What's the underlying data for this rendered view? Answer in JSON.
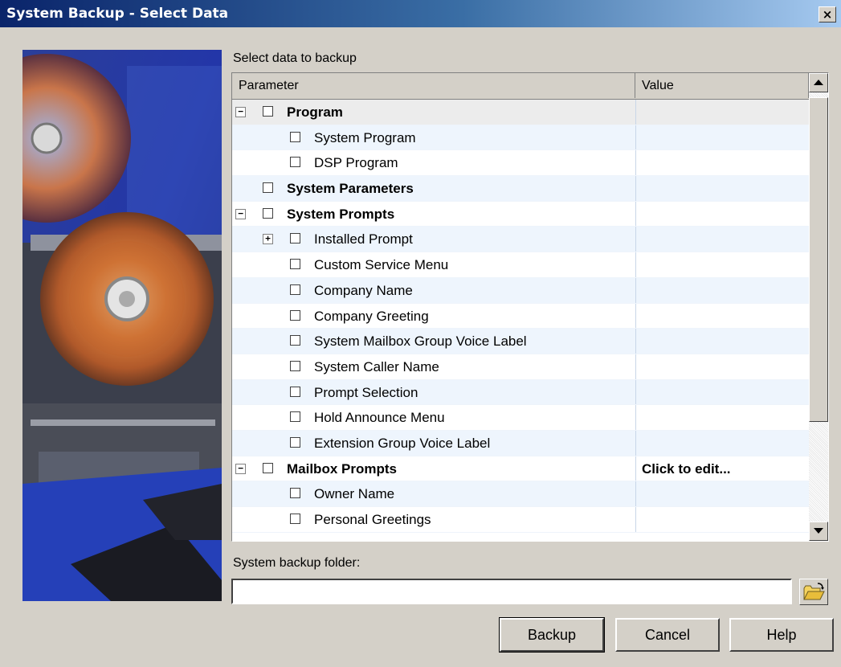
{
  "window": {
    "title": "System Backup - Select Data",
    "close_glyph": "×"
  },
  "select_label": "Select data to backup",
  "grid": {
    "columns": [
      "Parameter",
      "Value"
    ],
    "rows": [
      {
        "label": "Program",
        "bold": true,
        "level": 0,
        "expander": "−",
        "value": ""
      },
      {
        "label": "System Program",
        "bold": false,
        "level": 1,
        "expander": "",
        "value": ""
      },
      {
        "label": "DSP Program",
        "bold": false,
        "level": 1,
        "expander": "",
        "value": ""
      },
      {
        "label": "System Parameters",
        "bold": true,
        "level": 0,
        "expander": "",
        "value": ""
      },
      {
        "label": "System Prompts",
        "bold": true,
        "level": 0,
        "expander": "−",
        "value": ""
      },
      {
        "label": "Installed Prompt",
        "bold": false,
        "level": 1,
        "expander": "+",
        "value": ""
      },
      {
        "label": "Custom Service Menu",
        "bold": false,
        "level": 1,
        "expander": "",
        "value": ""
      },
      {
        "label": "Company Name",
        "bold": false,
        "level": 1,
        "expander": "",
        "value": ""
      },
      {
        "label": "Company Greeting",
        "bold": false,
        "level": 1,
        "expander": "",
        "value": ""
      },
      {
        "label": "System Mailbox Group Voice Label",
        "bold": false,
        "level": 1,
        "expander": "",
        "value": ""
      },
      {
        "label": "System Caller Name",
        "bold": false,
        "level": 1,
        "expander": "",
        "value": ""
      },
      {
        "label": "Prompt Selection",
        "bold": false,
        "level": 1,
        "expander": "",
        "value": ""
      },
      {
        "label": "Hold Announce Menu",
        "bold": false,
        "level": 1,
        "expander": "",
        "value": ""
      },
      {
        "label": "Extension Group Voice Label",
        "bold": false,
        "level": 1,
        "expander": "",
        "value": ""
      },
      {
        "label": "Mailbox Prompts",
        "bold": true,
        "level": 0,
        "expander": "−",
        "value": "Click to edit..."
      },
      {
        "label": "Owner Name",
        "bold": false,
        "level": 1,
        "expander": "",
        "value": ""
      },
      {
        "label": "Personal Greetings",
        "bold": false,
        "level": 1,
        "expander": "",
        "value": ""
      }
    ]
  },
  "folder": {
    "label": "System backup folder:",
    "value": ""
  },
  "buttons": {
    "backup": "Backup",
    "cancel": "Cancel",
    "help": "Help"
  },
  "icons": {
    "browse": "folder-open-icon",
    "scroll_up": "arrow-up-icon",
    "scroll_down": "arrow-down-icon"
  }
}
